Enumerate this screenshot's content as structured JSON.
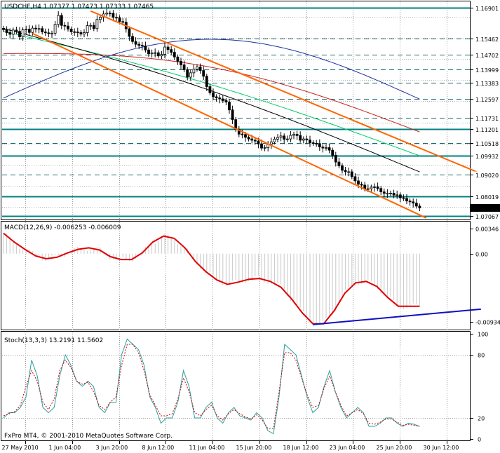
{
  "header": {
    "main": "USDCHF,H4  1.07377 1.07473 1.07333 1.07465",
    "macd": "MACD(12,26,9) -0.006253 -0.006009",
    "stoch": "Stoch(13,3,3) 13.2191 11.5602"
  },
  "footer": "FxPro MT4, © 2001-2010 MetaQuotes Software Corp.",
  "colors": {
    "candles": "#000000",
    "level_line": "#008080",
    "dashed_level": "#1a6b6b",
    "channel": "#ff6600",
    "ma_green": "#00cc66",
    "ma_black": "#000000",
    "ma_red": "#cc2222",
    "ma_blue": "#1f2f9f",
    "macd_signal": "#e00000",
    "macd_trend": "#1010c0",
    "stoch_main": "#2a9d9d",
    "stoch_signal": "#cc0000",
    "current_price_bg": "#000000"
  },
  "chart_data": [
    {
      "type": "candlestick",
      "symbol": "USDCHF",
      "timeframe": "H4",
      "ylim": [
        1.0695,
        1.1718
      ],
      "x_labels": [
        "27 May 2010",
        "1 Jun 04:00",
        "3 Jun 20:00",
        "8 Jun 12:00",
        "11 Jun 04:00",
        "15 Jun 20:00",
        "18 Jun 12:00",
        "23 Jun 04:00",
        "25 Jun 20:00",
        "30 Jun 12:00"
      ],
      "price_levels": [
        {
          "label": "1.16901",
          "value": 1.16901,
          "style": "solid"
        },
        {
          "label": "1.15462",
          "value": 1.15462,
          "style": "dashed"
        },
        {
          "label": "1.14702",
          "value": 1.14702,
          "style": "dashed"
        },
        {
          "label": "1.13999",
          "value": 1.13999,
          "style": "dashed"
        },
        {
          "label": "1.13383",
          "value": 1.13383,
          "style": "dashed"
        },
        {
          "label": "1.12597",
          "value": 1.12597,
          "style": "dashed"
        },
        {
          "label": "1.11731",
          "value": 1.11731,
          "style": "dashed"
        },
        {
          "label": "1.11201",
          "value": 1.11201,
          "style": "solid"
        },
        {
          "label": "1.10518",
          "value": 1.10518,
          "style": "dashed"
        },
        {
          "label": "1.09932",
          "value": 1.09932,
          "style": "solid"
        },
        {
          "label": "1.09020",
          "value": 1.0902,
          "style": "dashed"
        },
        {
          "label": "1.08019",
          "value": 1.08019,
          "style": "solid"
        },
        {
          "label": "1.07067",
          "value": 1.07067,
          "style": "solid"
        }
      ],
      "current_price": {
        "label": "1.07465",
        "value": 1.07465
      },
      "candles": {
        "count": 130,
        "close": [
          1.1588,
          1.1574,
          1.1566,
          1.1586,
          1.158,
          1.1554,
          1.1587,
          1.159,
          1.1575,
          1.1595,
          1.1592,
          1.1593,
          1.1577,
          1.1573,
          1.157,
          1.1571,
          1.1613,
          1.1655,
          1.1608,
          1.1605,
          1.1591,
          1.1578,
          1.1577,
          1.1574,
          1.1567,
          1.1574,
          1.1607,
          1.1608,
          1.1593,
          1.1636,
          1.1647,
          1.1662,
          1.1666,
          1.1665,
          1.1646,
          1.1644,
          1.1626,
          1.1623,
          1.1592,
          1.1556,
          1.1532,
          1.1519,
          1.1514,
          1.1511,
          1.1492,
          1.1474,
          1.1478,
          1.1479,
          1.1464,
          1.1471,
          1.1506,
          1.1494,
          1.1481,
          1.1459,
          1.1439,
          1.1422,
          1.1399,
          1.1364,
          1.1384,
          1.1402,
          1.1412,
          1.1395,
          1.1368,
          1.1319,
          1.129,
          1.1271,
          1.1266,
          1.1261,
          1.1253,
          1.1246,
          1.1209,
          1.1163,
          1.1117,
          1.1095,
          1.1093,
          1.108,
          1.1072,
          1.1066,
          1.1062,
          1.1049,
          1.1029,
          1.1031,
          1.1046,
          1.1058,
          1.1071,
          1.1079,
          1.1086,
          1.107,
          1.1072,
          1.1089,
          1.1094,
          1.1088,
          1.1066,
          1.1072,
          1.1067,
          1.1054,
          1.1051,
          1.105,
          1.1034,
          1.1029,
          1.1031,
          1.1019,
          1.0995,
          1.0963,
          1.0945,
          1.0924,
          1.0917,
          1.0917,
          1.0894,
          1.0874,
          1.0858,
          1.0854,
          1.0836,
          1.0837,
          1.0844,
          1.0846,
          1.0838,
          1.0822,
          1.0815,
          1.0815,
          1.0816,
          1.0807,
          1.0808,
          1.0794,
          1.0791,
          1.0779,
          1.0775,
          1.0769,
          1.0755,
          1.0746
        ]
      },
      "moving_averages": [
        {
          "color": "green",
          "start": 1.158,
          "end": 1.0995
        },
        {
          "color": "black",
          "start": 1.157,
          "end": 1.0908
        },
        {
          "color": "red",
          "start": 1.1475,
          "end": 1.1105
        },
        {
          "color": "blue",
          "start": 1.1265,
          "end": 1.13
        }
      ],
      "channel_lines": [
        {
          "from": {
            "bar": 27,
            "price": 1.1676
          },
          "to": {
            "bar": 149,
            "price": 1.0902
          }
        },
        {
          "from": {
            "bar": 9,
            "price": 1.157
          },
          "to": {
            "bar": 131,
            "price": 1.0699
          }
        }
      ]
    },
    {
      "type": "histogram+line",
      "name": "MACD(12,26,9)",
      "ylim": [
        -0.0104,
        0.0042
      ],
      "tick_labels": [
        "0.00346",
        "0.00",
        "-0.00934"
      ],
      "values_signal": [
        0.0028,
        0.0016,
        0.0006,
        -0.0003,
        -0.0007,
        -0.0005,
        0.0001,
        0.0006,
        0.0008,
        0.0005,
        -0.0004,
        -0.0008,
        -0.0008,
        0.0001,
        0.0016,
        0.0024,
        0.0021,
        0.0008,
        -0.0011,
        -0.0025,
        -0.0036,
        -0.0042,
        -0.0039,
        -0.0035,
        -0.0034,
        -0.0038,
        -0.0046,
        -0.0062,
        -0.0081,
        -0.0096,
        -0.0096,
        -0.0078,
        -0.0054,
        -0.004,
        -0.0038,
        -0.0045,
        -0.006,
        -0.0072,
        -0.0072,
        -0.0072
      ],
      "trendline": {
        "from": {
          "bar": 96,
          "value": -0.0097
        },
        "to": {
          "bar": 148,
          "value": -0.0076
        }
      }
    },
    {
      "type": "line",
      "name": "Stoch(13,3,3)",
      "ylim": [
        0,
        100
      ],
      "tick_labels": [
        "100",
        "80",
        "20",
        "0"
      ],
      "values_main": [
        20,
        25,
        25,
        30,
        40,
        75,
        60,
        30,
        25,
        30,
        60,
        80,
        70,
        55,
        50,
        55,
        50,
        30,
        25,
        35,
        35,
        80,
        95,
        90,
        85,
        70,
        40,
        30,
        15,
        20,
        20,
        35,
        65,
        50,
        20,
        20,
        30,
        35,
        20,
        15,
        25,
        30,
        22,
        20,
        18,
        25,
        20,
        8,
        5,
        40,
        90,
        85,
        80,
        60,
        40,
        25,
        30,
        50,
        65,
        45,
        30,
        20,
        25,
        30,
        25,
        12,
        12,
        15,
        20,
        20,
        15,
        12,
        15,
        14,
        12
      ],
      "values_signal": [
        22,
        24,
        26,
        32,
        50,
        65,
        55,
        35,
        28,
        38,
        65,
        75,
        68,
        55,
        52,
        54,
        45,
        32,
        28,
        35,
        40,
        70,
        90,
        90,
        82,
        65,
        42,
        32,
        22,
        22,
        24,
        38,
        58,
        45,
        25,
        22,
        28,
        32,
        22,
        18,
        24,
        28,
        24,
        21,
        19,
        23,
        18,
        10,
        10,
        45,
        82,
        82,
        75,
        58,
        42,
        30,
        32,
        48,
        60,
        45,
        32,
        22,
        25,
        28,
        24,
        15,
        14,
        16,
        19,
        19,
        16,
        13,
        14,
        13,
        12
      ]
    }
  ]
}
